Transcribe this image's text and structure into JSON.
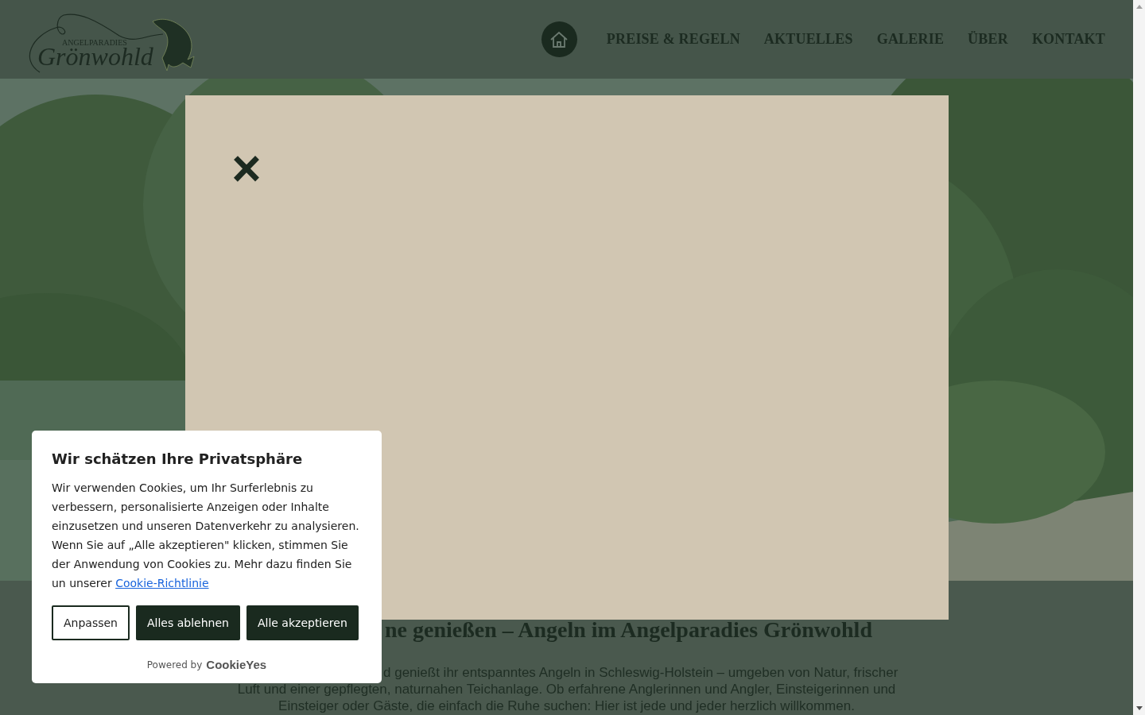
{
  "header": {
    "logo": {
      "small": "ANGELPARADIES",
      "large": "Grönwohld"
    },
    "nav": [
      {
        "kind": "home"
      },
      {
        "kind": "text",
        "label": "PREISE & REGELN"
      },
      {
        "kind": "text",
        "label": "AKTUELLES"
      },
      {
        "kind": "text",
        "label": "GALERIE"
      },
      {
        "kind": "text",
        "label": "ÜBER"
      },
      {
        "kind": "text",
        "label": "KONTAKT"
      }
    ]
  },
  "intro": {
    "heading": "ne genießen – Angeln im Angelparadies Grönwohld",
    "lines": [
      "d genießt ihr entspanntes Angeln in Schleswig-Holstein – umgeben von Natur, frischer",
      "Luft und einer gepflegten, naturnahen Teichanlage. Ob erfahrene Anglerinnen und Angler, Einsteigerinnen und",
      "Einsteiger oder Gäste, die einfach die Ruhe suchen: Hier ist jede und jeder herzlich willkommen."
    ]
  },
  "modal": {
    "close": "×"
  },
  "cookie_banner": {
    "title": "Wir schätzen Ihre Privatsphäre",
    "text": "Wir verwenden Cookies, um Ihr Surferlebnis zu verbessern, personalisierte Anzeigen oder Inhalte einzusetzen und unseren Datenverkehr zu analysieren. Wenn Sie auf „Alle akzeptieren\" klicken, stimmen Sie der Anwendung von Cookies zu. Mehr dazu finden Sie un unserer",
    "link": "Cookie-Richtlinie",
    "buttons": [
      {
        "label": "Anpassen",
        "kind": "outline"
      },
      {
        "label": "Alles ablehnen",
        "kind": "filled"
      },
      {
        "label": "Alle akzeptieren",
        "kind": "filled"
      }
    ],
    "powered_by": "Powered by",
    "brand": "CookieYes"
  }
}
